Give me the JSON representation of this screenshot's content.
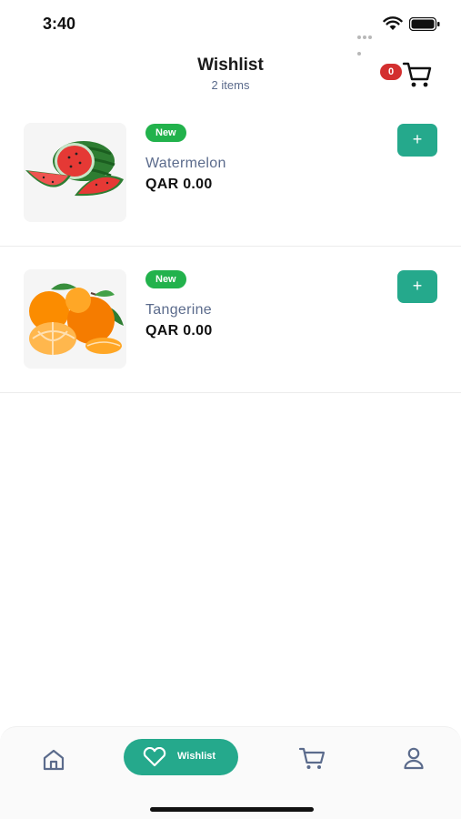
{
  "status_bar": {
    "time": "3:40"
  },
  "header": {
    "title": "Wishlist",
    "subtitle": "2 items",
    "cart_count": "0"
  },
  "items": [
    {
      "badge": "New",
      "name": "Watermelon",
      "price": "QAR 0.00",
      "add_label": "+",
      "image": "watermelon-image"
    },
    {
      "badge": "New",
      "name": "Tangerine",
      "price": "QAR 0.00",
      "add_label": "+",
      "image": "tangerine-image"
    }
  ],
  "bottom_nav": {
    "items": [
      {
        "icon": "home-icon",
        "label": ""
      },
      {
        "icon": "heart-icon",
        "label": "Wishlist",
        "active": true
      },
      {
        "icon": "cart-icon",
        "label": ""
      },
      {
        "icon": "profile-icon",
        "label": ""
      }
    ]
  },
  "colors": {
    "accent": "#25a98c",
    "badge_new": "#22b24c",
    "cart_badge": "#d32f2f",
    "item_name": "#5b6b8c"
  }
}
